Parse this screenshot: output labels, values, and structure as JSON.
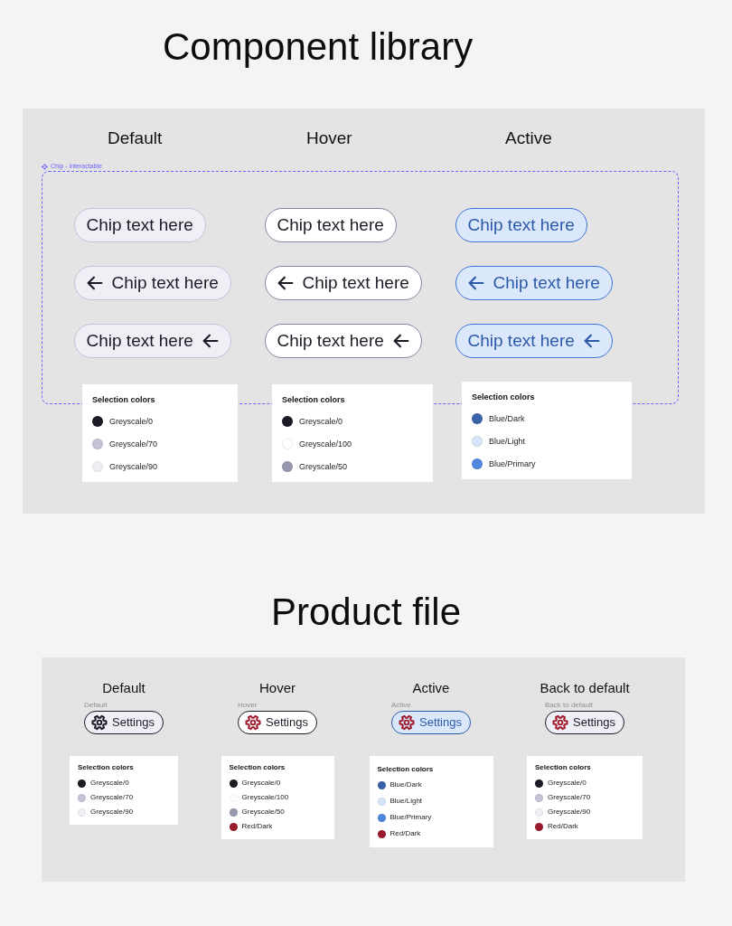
{
  "library": {
    "title": "Component library",
    "frame_label": "Chip - interactable",
    "columns": [
      {
        "heading": "Default",
        "kind": "default",
        "chips": [
          {
            "text": "Chip text here",
            "kind": "plain"
          },
          {
            "text": "Chip text here",
            "kind": "arrow-leading"
          },
          {
            "text": "Chip text here",
            "kind": "arrow-trailing"
          }
        ],
        "palette": {
          "title": "Selection colors",
          "swatches": [
            {
              "label": "Greyscale/0",
              "color": "#1a1b25"
            },
            {
              "label": "Greyscale/70",
              "color": "#c4c4d6"
            },
            {
              "label": "Greyscale/90",
              "color": "#efeff5"
            }
          ]
        }
      },
      {
        "heading": "Hover",
        "kind": "hover",
        "chips": [
          {
            "text": "Chip text here",
            "kind": "plain"
          },
          {
            "text": "Chip text here",
            "kind": "arrow-leading"
          },
          {
            "text": "Chip text here",
            "kind": "arrow-trailing"
          }
        ],
        "palette": {
          "title": "Selection colors",
          "swatches": [
            {
              "label": "Greyscale/0",
              "color": "#1a1b25"
            },
            {
              "label": "Greyscale/100",
              "color": "#ffffff"
            },
            {
              "label": "Greyscale/50",
              "color": "#9797ad"
            }
          ]
        }
      },
      {
        "heading": "Active",
        "kind": "active",
        "chips": [
          {
            "text": "Chip text here",
            "kind": "plain"
          },
          {
            "text": "Chip text here",
            "kind": "arrow-leading"
          },
          {
            "text": "Chip text here",
            "kind": "arrow-trailing"
          }
        ],
        "palette": {
          "title": "Selection colors",
          "swatches": [
            {
              "label": "Blue/Dark",
              "color": "#3a62a8"
            },
            {
              "label": "Blue/Light",
              "color": "#d6e6fa"
            },
            {
              "label": "Blue/Primary",
              "color": "#4f86e0"
            }
          ]
        }
      }
    ]
  },
  "product": {
    "title": "Product file",
    "columns": [
      {
        "heading": "Default",
        "caption": "Default",
        "kind": "default",
        "chip": {
          "text": "Settings",
          "icon": {
            "color": "#1a1b25"
          }
        },
        "palette": {
          "title": "Selection colors",
          "swatches": [
            {
              "label": "Greyscale/0",
              "color": "#1a1b25"
            },
            {
              "label": "Greyscale/70",
              "color": "#c4c4d6"
            },
            {
              "label": "Greyscale/90",
              "color": "#efeff5"
            }
          ]
        }
      },
      {
        "heading": "Hover",
        "caption": "Hover",
        "kind": "hover",
        "chip": {
          "text": "Settings",
          "icon": {
            "color": "#a01b2e"
          }
        },
        "palette": {
          "title": "Selection colors",
          "swatches": [
            {
              "label": "Greyscale/0",
              "color": "#1a1b25"
            },
            {
              "label": "Greyscale/100",
              "color": "#ffffff"
            },
            {
              "label": "Greyscale/50",
              "color": "#9797ad"
            },
            {
              "label": "Red/Dark",
              "color": "#9b1b2e"
            }
          ]
        }
      },
      {
        "heading": "Active",
        "caption": "Active",
        "kind": "active",
        "chip": {
          "text": "Settings",
          "icon": {
            "color": "#a01b2e"
          }
        },
        "palette": {
          "title": "Selection colors",
          "swatches": [
            {
              "label": "Blue/Dark",
              "color": "#3a62a8"
            },
            {
              "label": "Blue/Light",
              "color": "#d6e6fa"
            },
            {
              "label": "Blue/Primary",
              "color": "#4f86e0"
            },
            {
              "label": "Red/Dark",
              "color": "#9b1b2e"
            }
          ]
        }
      },
      {
        "heading": "Back to default",
        "caption": "Back to default",
        "kind": "default",
        "chip": {
          "text": "Settings",
          "icon": {
            "color": "#a01b2e"
          }
        },
        "palette": {
          "title": "Selection colors",
          "swatches": [
            {
              "label": "Greyscale/0",
              "color": "#1a1b25"
            },
            {
              "label": "Greyscale/70",
              "color": "#c4c4d6"
            },
            {
              "label": "Greyscale/90",
              "color": "#efeff5"
            },
            {
              "label": "Red/Dark",
              "color": "#9b1b2e"
            }
          ]
        }
      }
    ]
  }
}
